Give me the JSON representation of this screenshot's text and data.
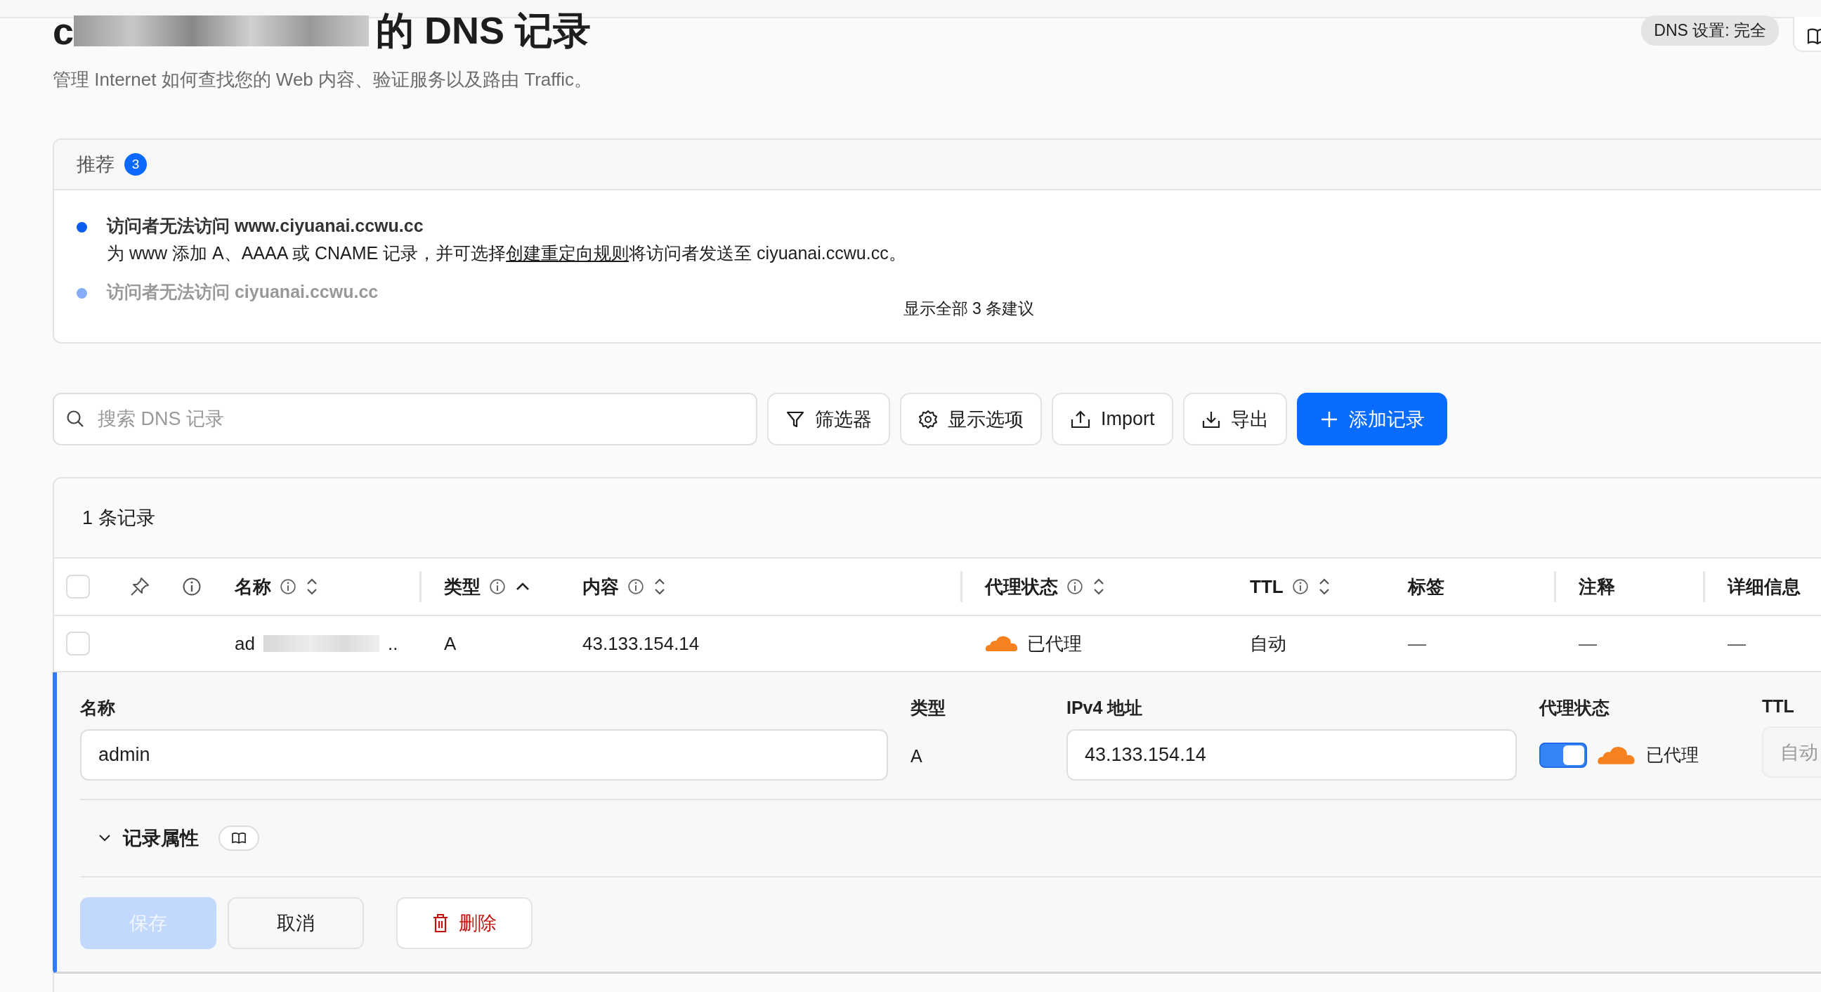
{
  "header": {
    "title_start": "c",
    "title_end": "的 DNS 记录",
    "subtitle": "管理 Internet 如何查找您的 Web 内容、验证服务以及路由 Traffic。",
    "settings_badge": "DNS 设置: 完全"
  },
  "recommendations": {
    "title": "推荐",
    "count": "3",
    "items": [
      {
        "title": "访问者无法访问 www.ciyuanai.ccwu.cc",
        "description_before": "为 www 添加 A、AAAA 或 CNAME 记录，并可选择",
        "link": "创建重定向规则",
        "description_after": "将访问者发送至 ciyuanai.ccwu.cc。",
        "faded": false
      },
      {
        "title": "访问者无法访问 ciyuanai.ccwu.cc",
        "faded": true
      }
    ],
    "show_all": "显示全部 3 条建议"
  },
  "toolbar": {
    "search_placeholder": "搜索 DNS 记录",
    "buttons": [
      {
        "label": "筛选器",
        "kind": "filter",
        "primary": false
      },
      {
        "label": "显示选项",
        "kind": "settings",
        "primary": false
      },
      {
        "label": "Import",
        "kind": "upload",
        "primary": false
      },
      {
        "label": "导出",
        "kind": "download",
        "primary": false
      },
      {
        "label": "添加记录",
        "kind": "add",
        "primary": true
      }
    ]
  },
  "table": {
    "count": "1 条记录",
    "select_all_checked": false,
    "columns": [
      {
        "label": "名称",
        "info": true,
        "sorted": false
      },
      {
        "label": "类型",
        "info": true,
        "sorted": true
      },
      {
        "label": "内容",
        "info": true,
        "sorted": false
      },
      {
        "label": "代理状态",
        "info": true,
        "sorted": false
      },
      {
        "label": "TTL",
        "info": true,
        "sorted": false
      },
      {
        "label": "标签"
      },
      {
        "label": "注释"
      },
      {
        "label": "详细信息"
      }
    ],
    "rows": [
      {
        "checked": false,
        "name_start": "ad",
        "name_end": "..",
        "type": "A",
        "content": "43.133.154.14",
        "proxied": true,
        "proxy_text": "已代理",
        "ttl": "自动",
        "tags": "—",
        "comment": "—",
        "details": "—"
      }
    ]
  },
  "editor": {
    "name_label": "名称",
    "name_value": "admin",
    "type_label": "类型",
    "type_value": "A",
    "ip_label": "IPv4 地址",
    "ip_value": "43.133.154.14",
    "proxy_label": "代理状态",
    "proxy_on": true,
    "proxy_text": "已代理",
    "ttl_label": "TTL",
    "ttl_value": "自动",
    "attributes": {
      "label": "记录属性",
      "expanded": true
    },
    "buttons": [
      {
        "label": "保存",
        "kind": "save",
        "disabled": true
      },
      {
        "label": "取消",
        "kind": "cancel"
      },
      {
        "label": "删除",
        "kind": "delete"
      }
    ]
  }
}
